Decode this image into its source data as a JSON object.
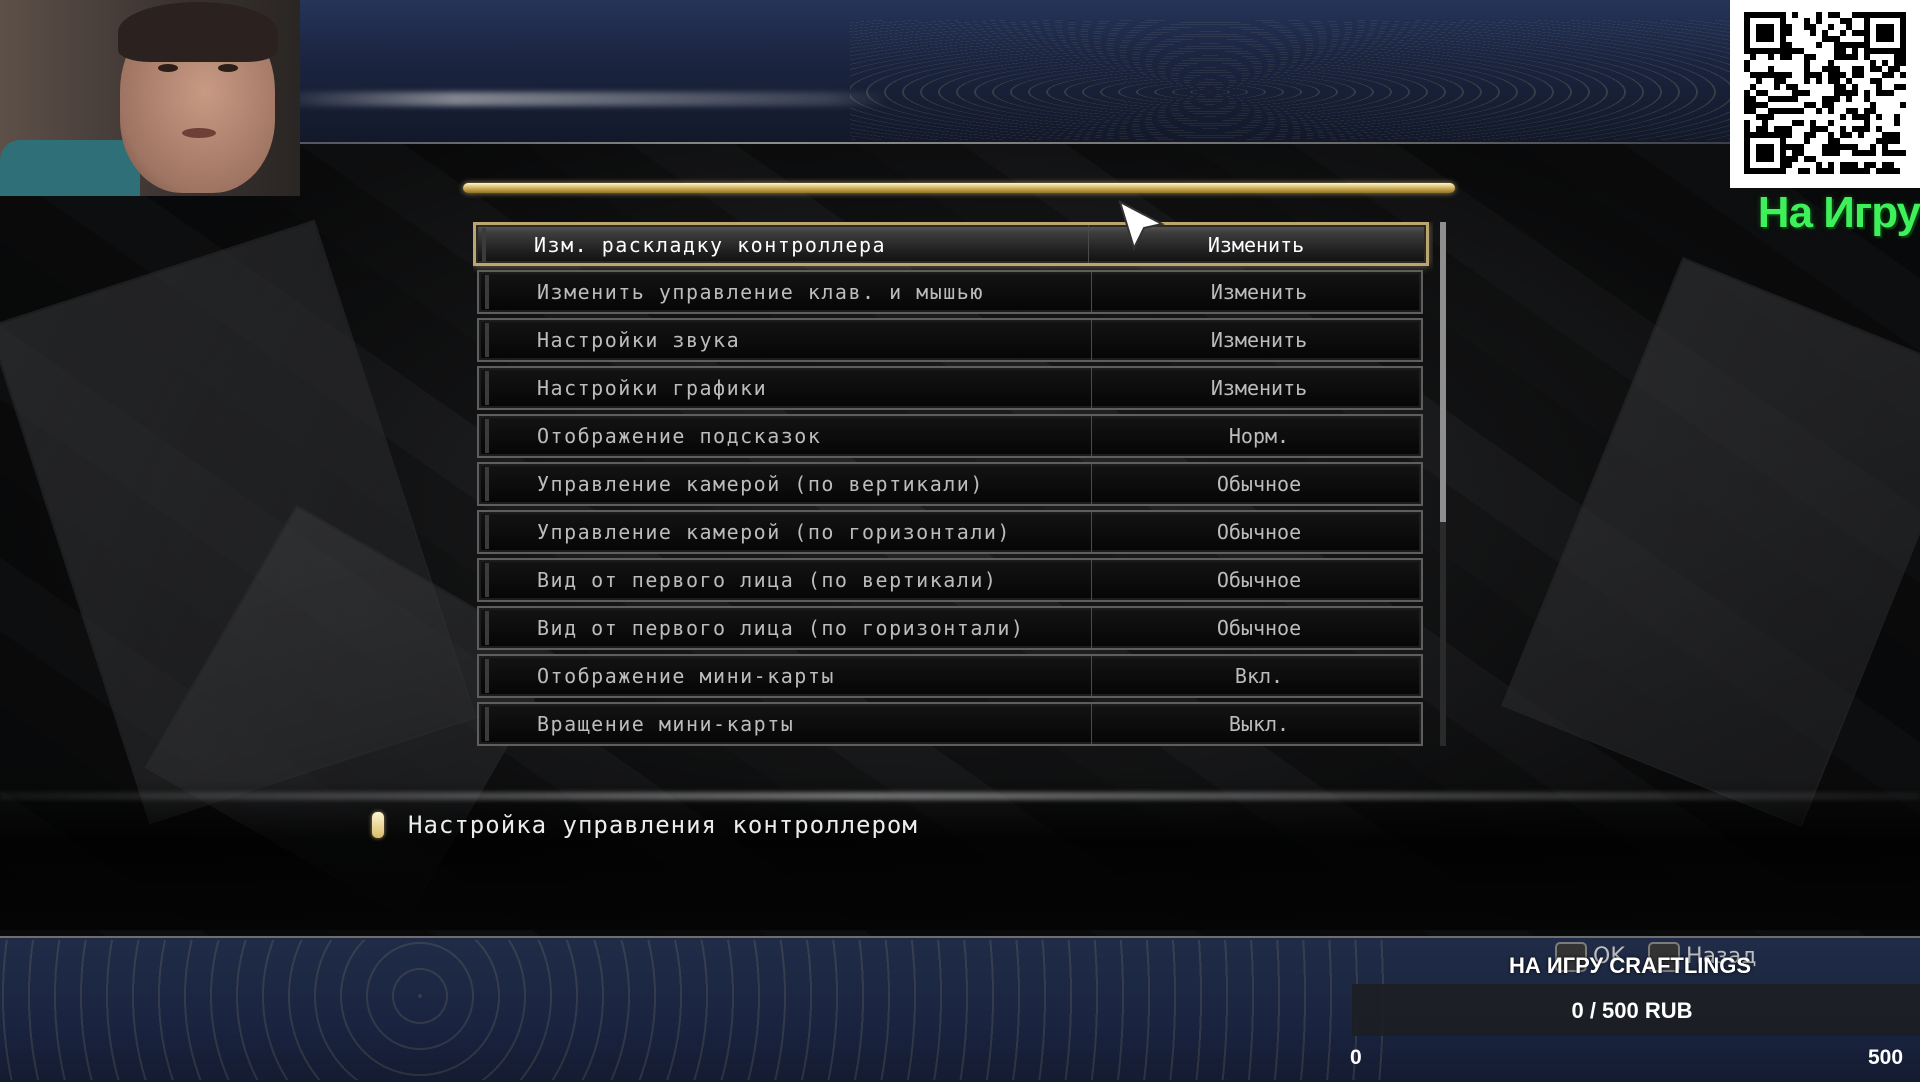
{
  "menu": {
    "items": [
      {
        "label": "Изм. раскладку контроллера",
        "value": "Изменить",
        "selected": true
      },
      {
        "label": "Изменить управление клав. и мышью",
        "value": "Изменить"
      },
      {
        "label": "Настройки звука",
        "value": "Изменить"
      },
      {
        "label": "Настройки графики",
        "value": "Изменить"
      },
      {
        "label": "Отображение подсказок",
        "value": "Норм."
      },
      {
        "label": "Управление камерой (по вертикали)",
        "value": "Обычное"
      },
      {
        "label": "Управление камерой (по горизонтали)",
        "value": "Обычное"
      },
      {
        "label": "Вид от первого лица (по вертикали)",
        "value": "Обычное"
      },
      {
        "label": "Вид от первого лица (по горизонтали)",
        "value": "Обычное"
      },
      {
        "label": "Отображение мини-карты",
        "value": "Вкл."
      },
      {
        "label": "Вращение мини-карты",
        "value": "Выкл."
      }
    ],
    "description": "Настройка управления контроллером"
  },
  "prompts": {
    "ok": "OK",
    "back": "Назад"
  },
  "overlay": {
    "promo_label": "На Игру",
    "donation": {
      "title": "НА ИГРУ CRAFTLINGS",
      "amount": "0 / 500 RUB",
      "min": "0",
      "max": "500",
      "progress": 0
    }
  },
  "colors": {
    "accent_gold": "#d3b35c",
    "promo_green": "#3ef05a",
    "band_blue": "#1b2540"
  }
}
